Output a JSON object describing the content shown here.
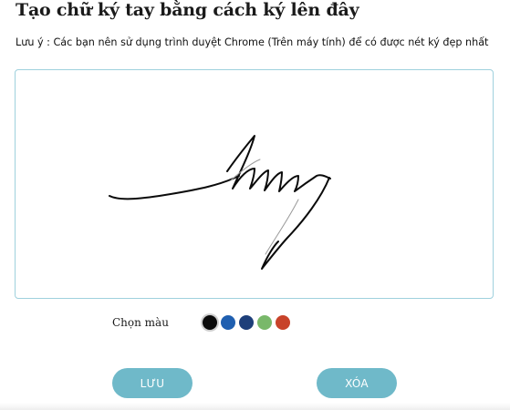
{
  "page": {
    "title": "Tạo chữ ký tay bằng cách ký lên đây",
    "note": "Lưu ý : Các bạn nên sử dụng trình duyệt Chrome (Trên máy tính) để có được nét ký đẹp nhất"
  },
  "color_picker": {
    "label": "Chọn màu",
    "selected": 0,
    "colors": [
      "#0b0b0b",
      "#1f5fb0",
      "#1e3f7a",
      "#79b86a",
      "#c8432a"
    ]
  },
  "actions": {
    "save_label": "LƯU",
    "clear_label": "XÓA"
  },
  "theme": {
    "accent": "#6fb9c9",
    "pad_border": "#9fd1dd",
    "stroke_color": "#0b0b0b"
  }
}
